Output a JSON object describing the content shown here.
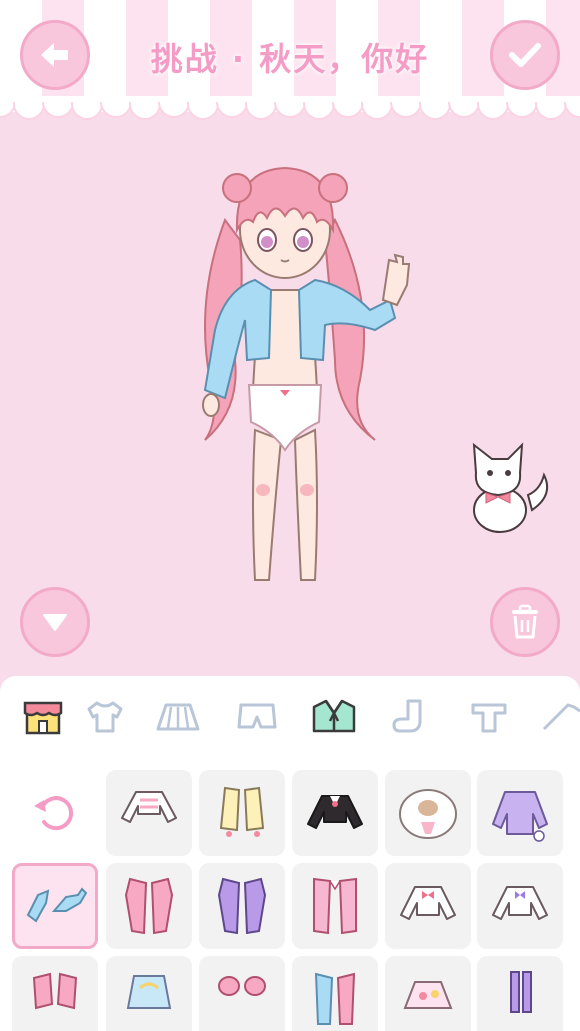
{
  "header": {
    "title": "挑战 · 秋天，你好"
  },
  "buttons": {
    "back": "back",
    "confirm": "confirm",
    "hide_panel": "hide-panel",
    "delete": "delete"
  },
  "categories": [
    {
      "name": "shop-icon",
      "active": false
    },
    {
      "name": "tshirt-icon",
      "active": false
    },
    {
      "name": "skirt-icon",
      "active": false
    },
    {
      "name": "shorts-icon",
      "active": false
    },
    {
      "name": "jacket-icon",
      "active": true
    },
    {
      "name": "sock-icon",
      "active": false
    },
    {
      "name": "top-icon",
      "active": false
    },
    {
      "name": "shoe-icon",
      "active": false
    }
  ],
  "items": [
    {
      "name": "reset-icon"
    },
    {
      "name": "white-striped-crop-top-icon"
    },
    {
      "name": "yellow-jacket-icon"
    },
    {
      "name": "black-sailor-top-icon"
    },
    {
      "name": "cat-print-shawl-icon"
    },
    {
      "name": "purple-bunny-hoodie-icon"
    },
    {
      "name": "blue-denim-jacket-icon",
      "selected": true
    },
    {
      "name": "pink-long-coat-icon"
    },
    {
      "name": "purple-long-coat-icon"
    },
    {
      "name": "pink-cape-icon"
    },
    {
      "name": "white-bow-blouse-icon"
    },
    {
      "name": "white-sailor-blouse-icon"
    },
    {
      "name": "pink-cardigan-icon"
    },
    {
      "name": "pastel-rainbow-hoodie-icon"
    },
    {
      "name": "pink-puff-sleeves-icon"
    },
    {
      "name": "pastel-blue-pink-jacket-icon"
    },
    {
      "name": "floral-blouse-icon"
    },
    {
      "name": "lavender-overalls-icon"
    }
  ],
  "colors": {
    "background": "#f8dcea",
    "accent": "#f3a9c8",
    "title": "#f49cc6",
    "panel": "#ffffff",
    "cell": "#f2f2f2"
  }
}
